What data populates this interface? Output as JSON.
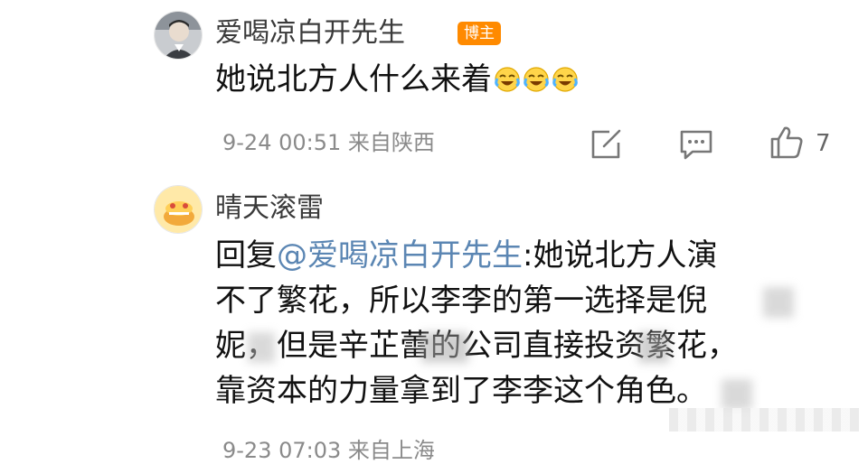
{
  "comments": [
    {
      "username": "爱喝凉白开先生",
      "badge": "博主",
      "text": "她说北方人什么来着",
      "emoji_icon": "laugh-cry-icon",
      "timestamp_location": "9-24 00:51 来自陕西",
      "like_count": "7"
    },
    {
      "username": "晴天滚雷",
      "reply_prefix": "回复",
      "mention": "@爱喝凉白开先生",
      "text_after_mention": ":她说北方人演",
      "lines": [
        "不了繁花，所以李李的第一选择是倪",
        "妮，但是辛芷蕾的公司直接投资繁花，",
        "靠资本的力量拿到了李李这个角色。"
      ],
      "timestamp_location": "9-23 07:03 来自上海"
    }
  ],
  "icons": {
    "share": "share-icon",
    "comment": "comment-icon",
    "like": "thumbs-up-icon"
  },
  "colors": {
    "badge": "#ff8a00",
    "mention": "#5b86b3",
    "meta": "#8a8a8a"
  }
}
